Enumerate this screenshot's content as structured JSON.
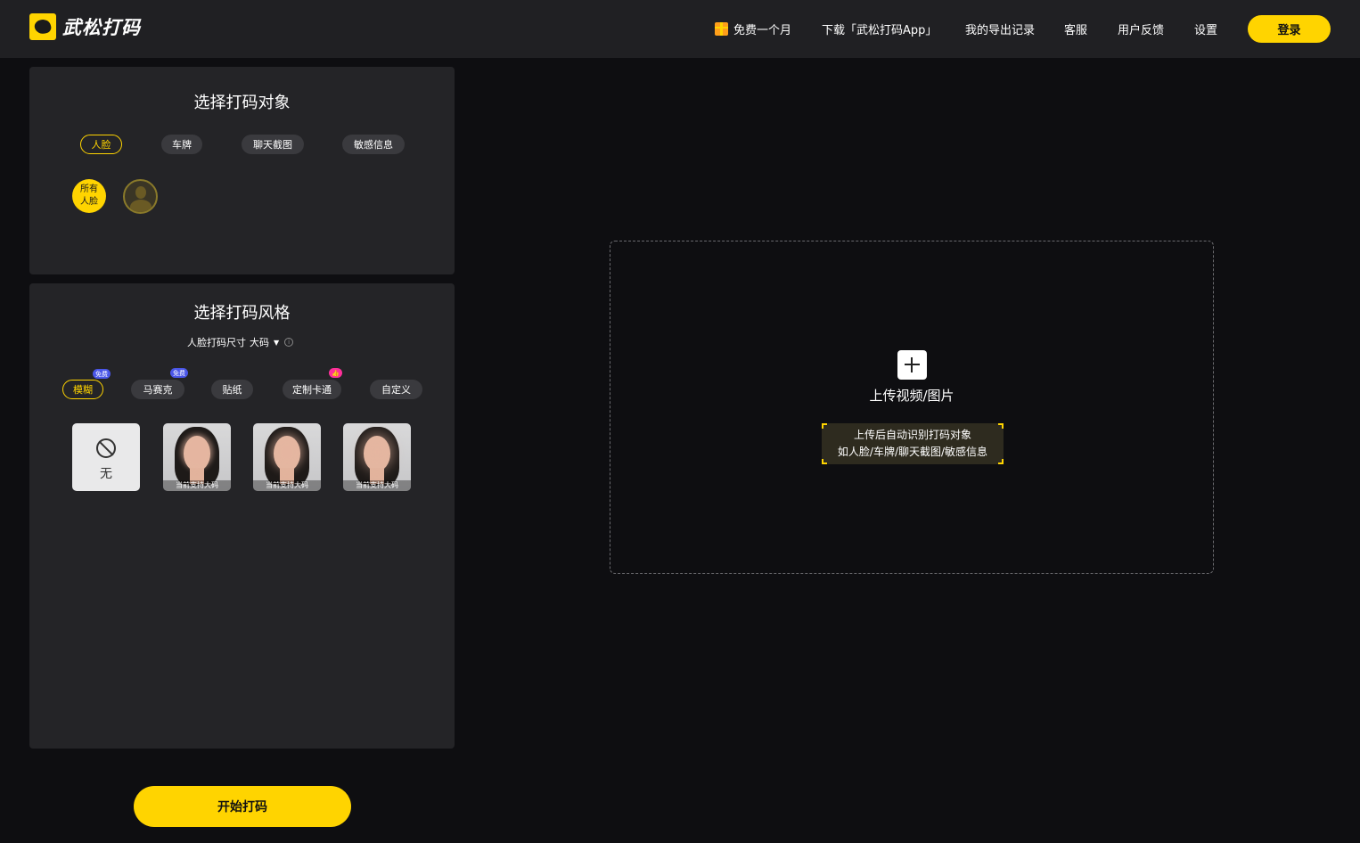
{
  "header": {
    "logo_text": "武松打码",
    "nav": {
      "free_month": "免费一个月",
      "download": "下载「武松打码App」",
      "export_history": "我的导出记录",
      "service": "客服",
      "feedback": "用户反馈",
      "settings": "设置"
    },
    "login": "登录"
  },
  "target_panel": {
    "title": "选择打码对象",
    "tabs": [
      "人脸",
      "车牌",
      "聊天截图",
      "敏感信息"
    ],
    "active_tab": "人脸",
    "all_faces": "所有\n人脸"
  },
  "style_panel": {
    "title": "选择打码风格",
    "size_label": "人脸打码尺寸",
    "size_value": "大码",
    "styles": [
      {
        "label": "模糊",
        "badge": "免费"
      },
      {
        "label": "马赛克",
        "badge": "免费"
      },
      {
        "label": "贴纸",
        "badge": ""
      },
      {
        "label": "定制卡通",
        "badge": "👍"
      },
      {
        "label": "自定义",
        "badge": ""
      }
    ],
    "active_style": "模糊",
    "none_label": "无",
    "thumb_caption": "当前支持大码"
  },
  "start_button": "开始打码",
  "upload": {
    "label": "上传视频/图片",
    "hint_line1": "上传后自动识别打码对象",
    "hint_line2": "如人脸/车牌/聊天截图/敏感信息"
  },
  "colors": {
    "accent": "#ffd400",
    "background": "#0e0e11",
    "header": "#202023",
    "panel": "#242427"
  }
}
